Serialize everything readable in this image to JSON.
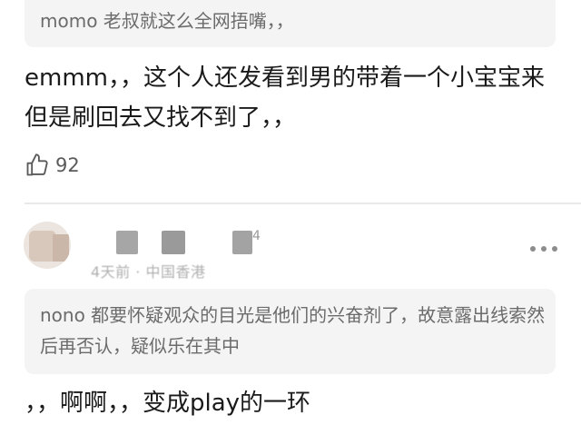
{
  "comment1": {
    "quote": "momo 老叔就这么全网捂嘴，，",
    "text": "emmm，，这个人还发看到男的带着一个小宝宝来但是刷回去又找不到了，，",
    "likes": "92",
    "like_icon": "thumbs-up-icon"
  },
  "comment2": {
    "name_fragment": "4",
    "meta": "4天前 · 中国香港",
    "quote": "nono 都要怀疑观众的目光是他们的兴奋剂了，故意露出线索然后再否认，疑似乐在其中",
    "text": "，，啊啊，，变成play的一环",
    "more_icon": "more-dots-icon"
  },
  "colors": {
    "background": "#ffffff",
    "quote_bg": "#f4f4f5",
    "quote_text": "#6b6b6b",
    "main_text": "#1a1a1a",
    "secondary_text": "#5a5a5a"
  }
}
